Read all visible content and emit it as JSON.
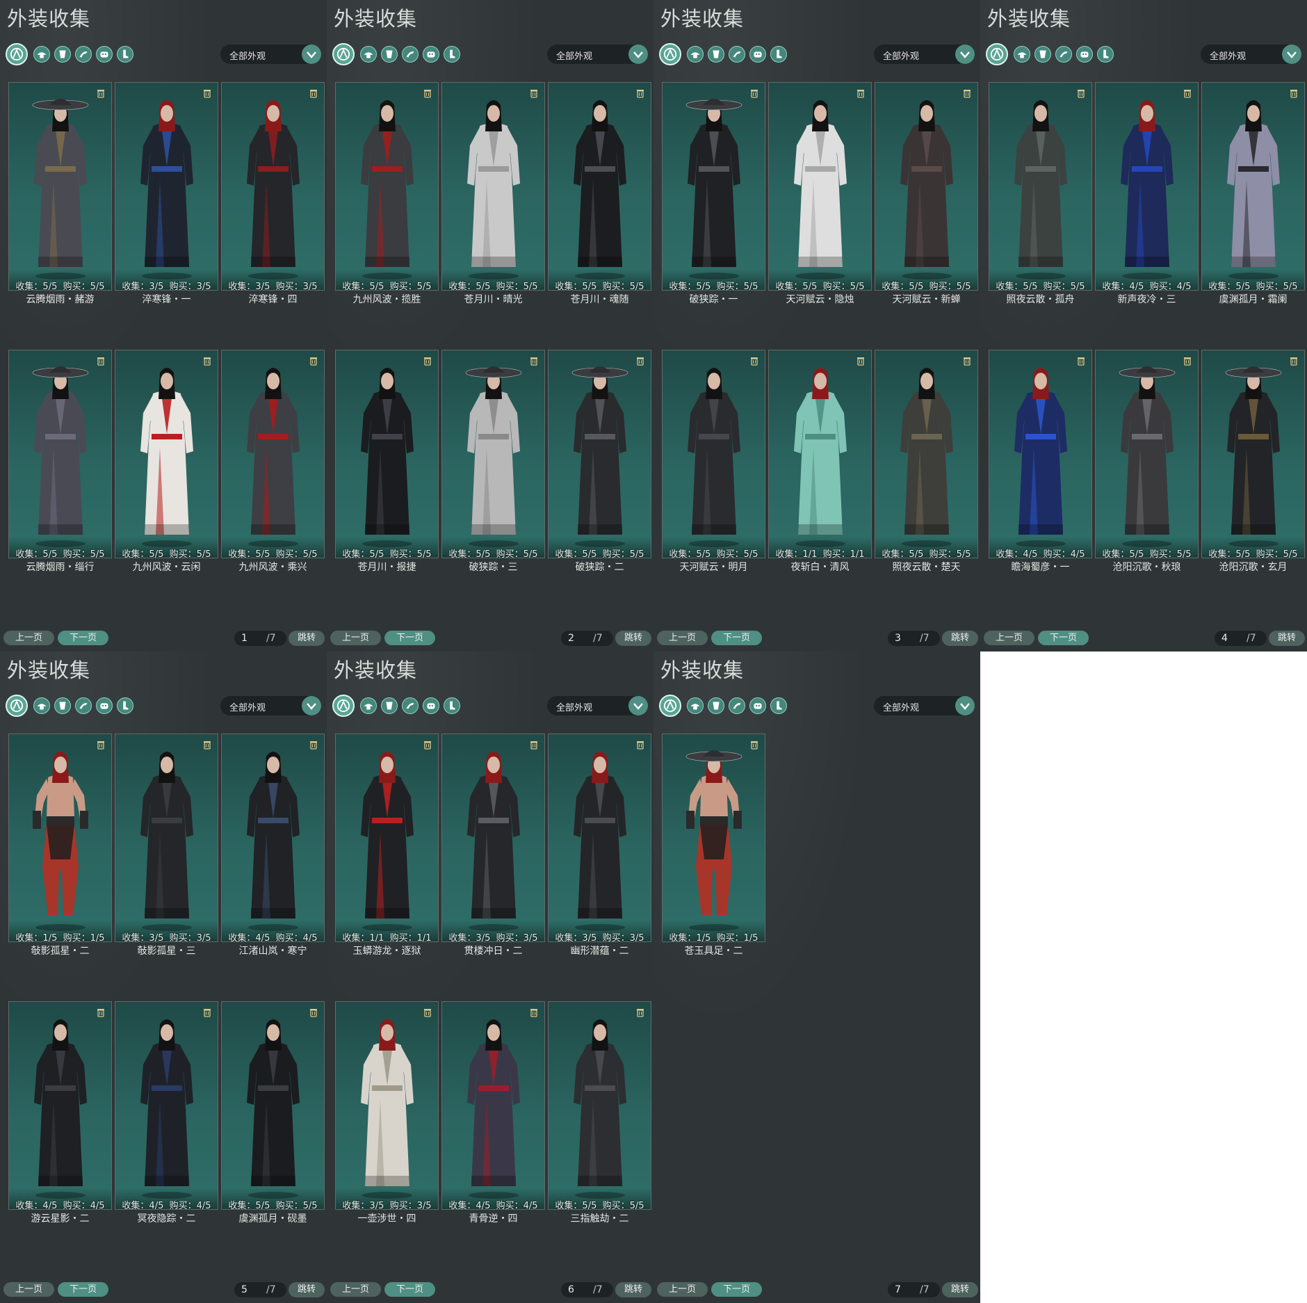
{
  "title": "外装收集",
  "filter_label": "全部外观",
  "filter_icons": [
    "all-appearance-icon",
    "hat-icon",
    "robe-icon",
    "sleeve-icon",
    "mask-icon",
    "boots-icon"
  ],
  "pagination": {
    "prev_label": "上一页",
    "next_label": "下一页",
    "total": "/7",
    "jump_label": "跳转"
  },
  "colors": {
    "panel_bg": "#2f3537",
    "card_bg": "#2b6560",
    "accent": "#4f8f84",
    "right_area": "#ffffff"
  },
  "panels": [
    {
      "page": "1",
      "items": [
        {
          "collect": "收集：5/5",
          "buy": "购买：5/5",
          "name": "云腾烟雨・赭游",
          "hair": "#121212",
          "robe": "#4a4a52",
          "accent": "#7a6a4a",
          "hat": "wide"
        },
        {
          "collect": "收集：3/5",
          "buy": "购买：3/5",
          "name": "淬寒锋・一",
          "hair": "#8a1a1a",
          "robe": "#1f2530",
          "accent": "#2d4f9a",
          "hat": ""
        },
        {
          "collect": "收集：3/5",
          "buy": "购买：3/5",
          "name": "淬寒锋・四",
          "hair": "#8a1a1a",
          "robe": "#24262a",
          "accent": "#8a1e1e",
          "hat": ""
        },
        {
          "collect": "收集：5/5",
          "buy": "购买：5/5",
          "name": "云腾烟雨・缁行",
          "hair": "#121212",
          "robe": "#4a4a55",
          "accent": "#6a6a7a",
          "hat": "wide"
        },
        {
          "collect": "收集：5/5",
          "buy": "购买：5/5",
          "name": "九州风波・云闲",
          "hair": "#121212",
          "robe": "#e8e4e0",
          "accent": "#b81f1f",
          "hat": ""
        },
        {
          "collect": "收集：5/5",
          "buy": "购买：5/5",
          "name": "九州风波・乘兴",
          "hair": "#121212",
          "robe": "#3d3f44",
          "accent": "#a51c1c",
          "hat": ""
        }
      ]
    },
    {
      "page": "2",
      "items": [
        {
          "collect": "收集：5/5",
          "buy": "购买：5/5",
          "name": "九州风波・揽胜",
          "hair": "#121212",
          "robe": "#3a3c40",
          "accent": "#a11d1d",
          "hat": ""
        },
        {
          "collect": "收集：5/5",
          "buy": "购买：5/5",
          "name": "苍月川・晴光",
          "hair": "#121212",
          "robe": "#c9c9c9",
          "accent": "#9a9a9a",
          "hat": ""
        },
        {
          "collect": "收集：5/5",
          "buy": "购买：5/5",
          "name": "苍月川・魂随",
          "hair": "#121212",
          "robe": "#1c1d20",
          "accent": "#4a4d52",
          "hat": ""
        },
        {
          "collect": "收集：5/5",
          "buy": "购买：5/5",
          "name": "苍月川・报捷",
          "hair": "#121212",
          "robe": "#1b1c1f",
          "accent": "#3f4248",
          "hat": ""
        },
        {
          "collect": "收集：5/5",
          "buy": "购买：5/5",
          "name": "破狭踪・三",
          "hair": "#121212",
          "robe": "#b8b8b8",
          "accent": "#8a8a8a",
          "hat": "wide"
        },
        {
          "collect": "收集：5/5",
          "buy": "购买：5/5",
          "name": "破狭踪・二",
          "hair": "#121212",
          "robe": "#2a2b2e",
          "accent": "#55585e",
          "hat": "wide"
        }
      ]
    },
    {
      "page": "3",
      "items": [
        {
          "collect": "收集：5/5",
          "buy": "购买：5/5",
          "name": "破狭踪・一",
          "hair": "#121212",
          "robe": "#202124",
          "accent": "#505358",
          "hat": "wide"
        },
        {
          "collect": "收集：5/5",
          "buy": "购买：5/5",
          "name": "天河赋云・隐烛",
          "hair": "#121212",
          "robe": "#dedede",
          "accent": "#a8a8a8",
          "hat": ""
        },
        {
          "collect": "收集：5/5",
          "buy": "购买：5/5",
          "name": "天河赋云・新蝉",
          "hair": "#121212",
          "robe": "#3a3434",
          "accent": "#5a4a4a",
          "hat": ""
        },
        {
          "collect": "收集：5/5",
          "buy": "购买：5/5",
          "name": "天河赋云・明月",
          "hair": "#121212",
          "robe": "#2a2b2e",
          "accent": "#45474c",
          "hat": ""
        },
        {
          "collect": "收集：1/1",
          "buy": "购买：1/1",
          "name": "夜斩白・清风",
          "hair": "#8a1a1a",
          "robe": "#7fc4b4",
          "accent": "#4e8f82",
          "hat": ""
        },
        {
          "collect": "收集：5/5",
          "buy": "购买：5/5",
          "name": "照夜云散・楚天",
          "hair": "#121212",
          "robe": "#3e3e3a",
          "accent": "#6a6450",
          "hat": ""
        }
      ]
    },
    {
      "page": "4",
      "items": [
        {
          "collect": "收集：5/5",
          "buy": "购买：5/5",
          "name": "照夜云散・孤舟",
          "hair": "#121212",
          "robe": "#3c4240",
          "accent": "#5c6460",
          "hat": ""
        },
        {
          "collect": "收集：4/5",
          "buy": "购买：4/5",
          "name": "新声夜冷・三",
          "hair": "#8a1a1a",
          "robe": "#1e2a5a",
          "accent": "#2546b8",
          "hat": ""
        },
        {
          "collect": "收集：5/5",
          "buy": "购买：5/5",
          "name": "虞渊孤月・霜阑",
          "hair": "#121212",
          "robe": "#8e8ea6",
          "accent": "#2a2a30",
          "hat": ""
        },
        {
          "collect": "收集：4/5",
          "buy": "购买：4/5",
          "name": "瞻海蜀彦・一",
          "hair": "#8a1a1a",
          "robe": "#1e2c66",
          "accent": "#2a55c8",
          "hat": ""
        },
        {
          "collect": "收集：5/5",
          "buy": "购买：5/5",
          "name": "沧阳沉歌・秋琅",
          "hair": "#121212",
          "robe": "#3a3a3c",
          "accent": "#6a6a6e",
          "hat": "wide"
        },
        {
          "collect": "收集：5/5",
          "buy": "购买：5/5",
          "name": "沧阳沉歌・玄月",
          "hair": "#121212",
          "robe": "#222428",
          "accent": "#6a5a3a",
          "hat": "wide"
        }
      ]
    },
    {
      "page": "5",
      "items": [
        {
          "collect": "收集：1/5",
          "buy": "购买：1/5",
          "name": "敧影孤星・二",
          "hair": "#8a1a1a",
          "robe": "#a8352a",
          "accent": "#2a2a2a",
          "hat": "bare"
        },
        {
          "collect": "收集：3/5",
          "buy": "购买：3/5",
          "name": "敧影孤星・三",
          "hair": "#121212",
          "robe": "#24262a",
          "accent": "#3a3c40",
          "hat": ""
        },
        {
          "collect": "收集：4/5",
          "buy": "购买：4/5",
          "name": "江渚山岚・寒宁",
          "hair": "#121212",
          "robe": "#202226",
          "accent": "#3a4a6a",
          "hat": ""
        },
        {
          "collect": "收集：4/5",
          "buy": "购买：4/5",
          "name": "游云星影・二",
          "hair": "#121212",
          "robe": "#1e2024",
          "accent": "#3a3c42",
          "hat": ""
        },
        {
          "collect": "收集：4/5",
          "buy": "购买：4/5",
          "name": "冥夜隐踪・二",
          "hair": "#121212",
          "robe": "#1e2228",
          "accent": "#2a3a66",
          "hat": ""
        },
        {
          "collect": "收集：5/5",
          "buy": "购买：5/5",
          "name": "虞渊孤月・砚墨",
          "hair": "#121212",
          "robe": "#1b1c1f",
          "accent": "#3a3c42",
          "hat": ""
        }
      ]
    },
    {
      "page": "6",
      "items": [
        {
          "collect": "收集：1/1",
          "buy": "购买：1/1",
          "name": "玉蟒游龙・逐狱",
          "hair": "#8a1a1a",
          "robe": "#202124",
          "accent": "#b82020",
          "hat": ""
        },
        {
          "collect": "收集：3/5",
          "buy": "购买：3/5",
          "name": "贯楼冲日・二",
          "hair": "#8a1a1a",
          "robe": "#26272a",
          "accent": "#5a5c62",
          "hat": ""
        },
        {
          "collect": "收集：3/5",
          "buy": "购买：3/5",
          "name": "幽形潜蕴・二",
          "hair": "#8a1a1a",
          "robe": "#242528",
          "accent": "#4a4c50",
          "hat": ""
        },
        {
          "collect": "收集：3/5",
          "buy": "购买：3/5",
          "name": "一壶涉世・四",
          "hair": "#8a1a1a",
          "robe": "#d8d4cc",
          "accent": "#a09a8a",
          "hat": ""
        },
        {
          "collect": "收集：4/5",
          "buy": "购买：4/5",
          "name": "青骨逆・四",
          "hair": "#121212",
          "robe": "#3a3848",
          "accent": "#9a1e2a",
          "hat": ""
        },
        {
          "collect": "收集：5/5",
          "buy": "购买：5/5",
          "name": "三指触劫・二",
          "hair": "#121212",
          "robe": "#2c2e32",
          "accent": "#4a4c52",
          "hat": ""
        }
      ]
    },
    {
      "page": "7",
      "items": [
        {
          "collect": "收集：1/5",
          "buy": "购买：1/5",
          "name": "苍玉具足・二",
          "hair": "#8a1a1a",
          "robe": "#a8352a",
          "accent": "#2a2a2a",
          "hat": "bare-wide"
        }
      ]
    }
  ]
}
